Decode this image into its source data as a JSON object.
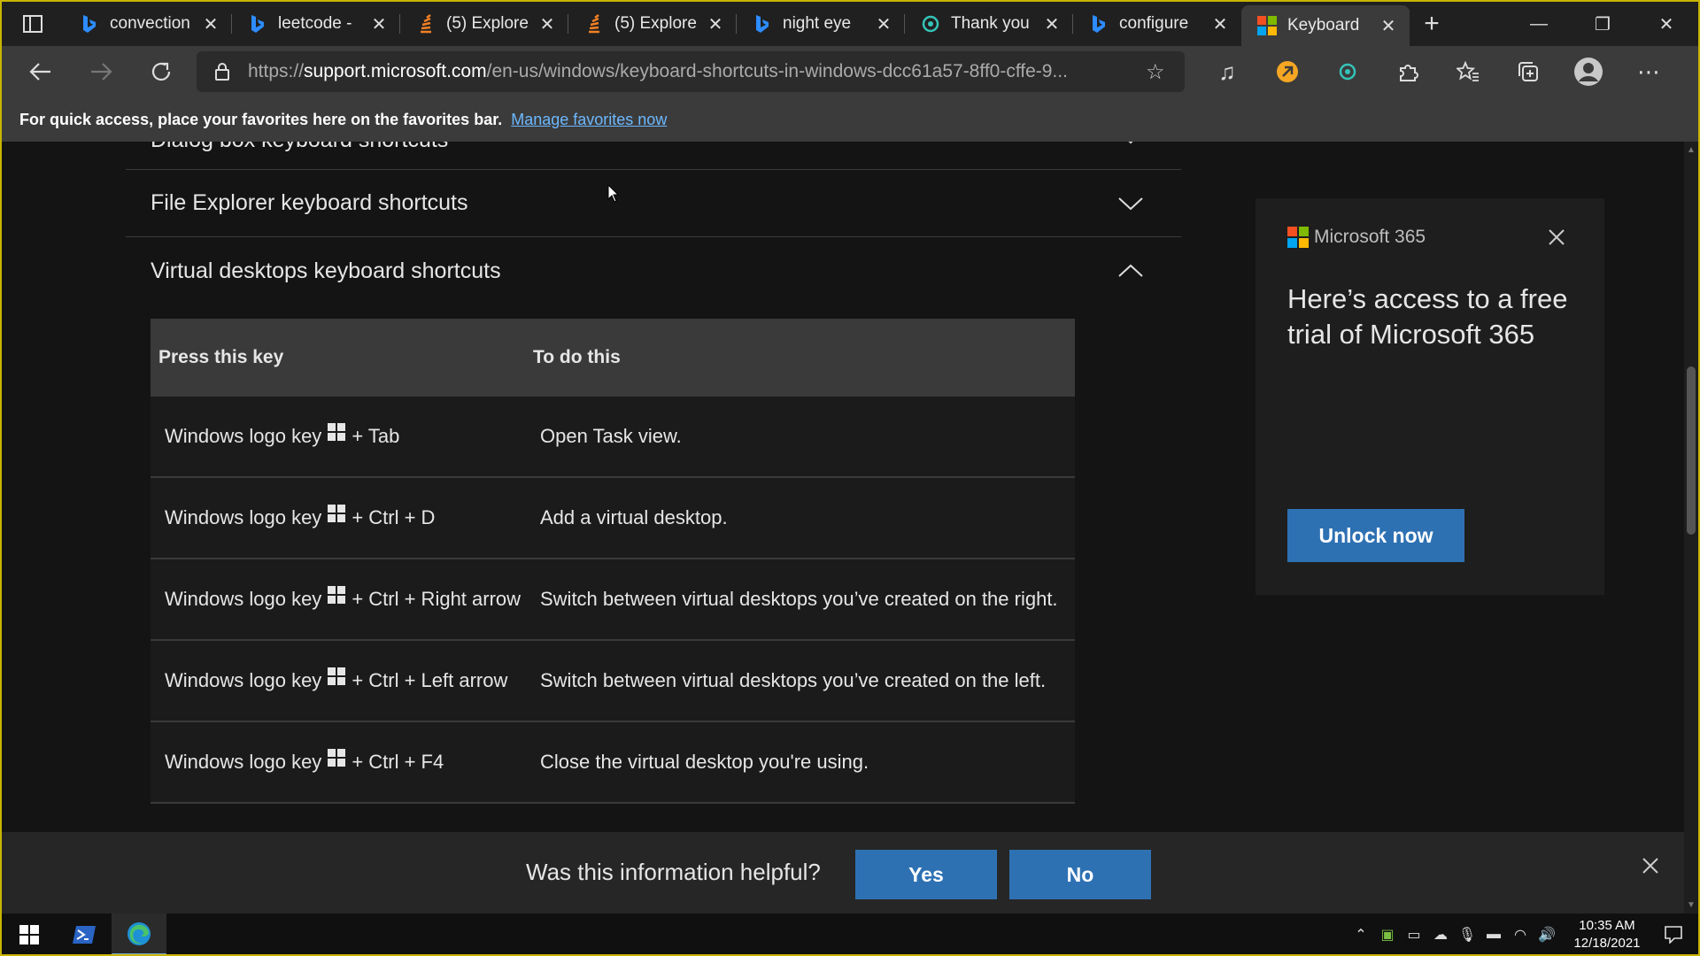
{
  "browser": {
    "tabs": [
      {
        "label": "convection",
        "favicon": "bing-icon"
      },
      {
        "label": "leetcode -",
        "favicon": "bing-icon"
      },
      {
        "label": "(5) Explore",
        "favicon": "stack-exchange-icon"
      },
      {
        "label": "(5) Explore",
        "favicon": "stack-exchange-icon"
      },
      {
        "label": "night eye",
        "favicon": "bing-icon"
      },
      {
        "label": "Thank you",
        "favicon": "circle-icon"
      },
      {
        "label": "configure",
        "favicon": "bing-icon"
      },
      {
        "label": "Keyboard",
        "favicon": "microsoft-icon",
        "active": true
      }
    ],
    "url_scheme": "https://",
    "url_host": "support.microsoft.com",
    "url_path": "/en-us/windows/keyboard-shortcuts-in-windows-dcc61a57-8ff0-cffe-9...",
    "favorites_message": "For quick access, place your favorites here on the favorites bar.",
    "favorites_link": "Manage favorites now"
  },
  "page": {
    "accordions": [
      {
        "title": "Dialog box keyboard shortcuts",
        "expanded": false
      },
      {
        "title": "File Explorer keyboard shortcuts",
        "expanded": false
      },
      {
        "title": "Virtual desktops keyboard shortcuts",
        "expanded": true
      }
    ],
    "table": {
      "headers": [
        "Press this key",
        "To do this"
      ],
      "rows": [
        {
          "key_prefix": "Windows logo key",
          "key_suffix": "+ Tab",
          "action": "Open Task view."
        },
        {
          "key_prefix": "Windows logo key",
          "key_suffix": "+ Ctrl + D",
          "action": "Add a virtual desktop."
        },
        {
          "key_prefix": "Windows logo key",
          "key_suffix": "+ Ctrl + Right arrow",
          "action": "Switch between virtual desktops you’ve created on the right."
        },
        {
          "key_prefix": "Windows logo key",
          "key_suffix": "+ Ctrl + Left arrow",
          "action": "Switch between virtual desktops you’ve created on the left."
        },
        {
          "key_prefix": "Windows logo key",
          "key_suffix": "+ Ctrl + F4",
          "action": "Close the virtual desktop you're using."
        }
      ]
    },
    "promo": {
      "brand": "Microsoft 365",
      "headline": "Here’s access to a free trial of Microsoft 365",
      "button": "Unlock now"
    },
    "feedback": {
      "question": "Was this information helpful?",
      "yes": "Yes",
      "no": "No"
    }
  },
  "taskbar": {
    "time": "10:35 AM",
    "date": "12/18/2021"
  },
  "colors": {
    "accent_button": "#2e71b3",
    "link": "#6cb8ff",
    "border_highlight": "#c9b400"
  }
}
